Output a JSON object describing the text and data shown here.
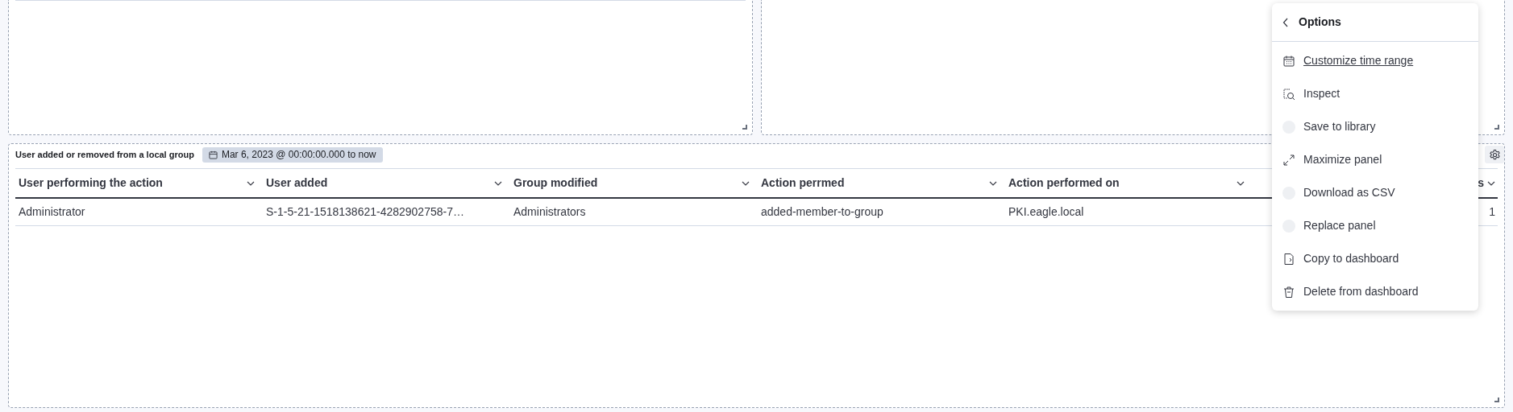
{
  "panel": {
    "title": "User added or removed from a local group",
    "time_badge": "Mar 6, 2023 @ 00:00:00.000 to now",
    "table": {
      "columns": [
        {
          "label": "User performing the action"
        },
        {
          "label": "User added"
        },
        {
          "label": "Group modified"
        },
        {
          "label": "Action perrmed"
        },
        {
          "label": "Action performed on"
        },
        {
          "label": "s"
        }
      ],
      "rows": [
        [
          "Administrator",
          "S-1-5-21-1518138621-4282902758-7…",
          "Administrators",
          "added-member-to-group",
          "PKI.eagle.local",
          "1"
        ]
      ]
    }
  },
  "options_menu": {
    "title": "Options",
    "items": [
      {
        "kind": "calendar",
        "label": "Customize time range",
        "hovered": true
      },
      {
        "kind": "inspect",
        "label": "Inspect",
        "hovered": false
      },
      {
        "kind": "loading",
        "label": "Save to library",
        "hovered": false
      },
      {
        "kind": "maximize",
        "label": "Maximize panel",
        "hovered": false
      },
      {
        "kind": "loading",
        "label": "Download as CSV",
        "hovered": false
      },
      {
        "kind": "loading",
        "label": "Replace panel",
        "hovered": false
      },
      {
        "kind": "copy",
        "label": "Copy to dashboard",
        "hovered": false
      },
      {
        "kind": "delete",
        "label": "Delete from dashboard",
        "hovered": false
      }
    ]
  }
}
